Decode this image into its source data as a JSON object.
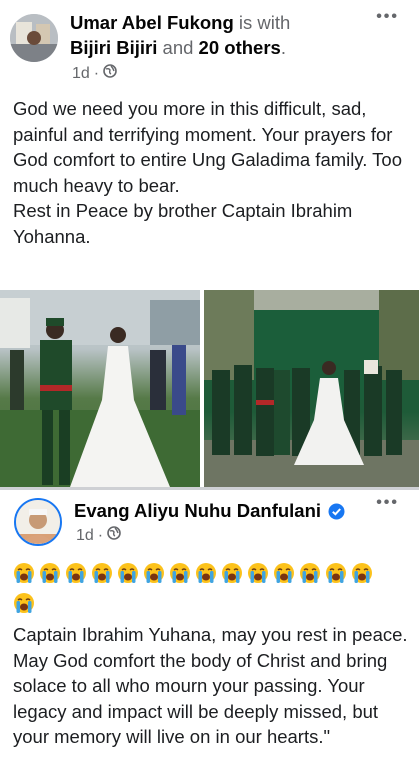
{
  "post1": {
    "author": "Umar Abel Fukong",
    "with_text": "is with",
    "tagged_1": "Bijiri Bijiri",
    "and_text": "and",
    "tagged_others": "20 others",
    "period": ".",
    "time": "1d",
    "dot": "·",
    "body": "God we need you more in this difficult, sad, painful and terrifying moment. Your prayers for God comfort to entire Ung Galadima family. Too much heavy to bear.\nRest in Peace by brother Captain Ibrahim Yohanna."
  },
  "post2": {
    "author": "Evang Aliyu Nuhu Danfulani",
    "time": "1d",
    "dot": "·",
    "emoji_count": 15,
    "emoji_name": "loudly-crying-face",
    "body": "Captain Ibrahim Yuhana, may you rest in peace. May God comfort the body of Christ and bring solace to all who mourn your passing. Your legacy and impact will be deeply missed, but your memory will live on in our hearts.\""
  },
  "icons": {
    "more": "•••",
    "globe": "globe-icon",
    "verified": "verified-badge-icon"
  },
  "colors": {
    "verified_blue": "#1877f2",
    "muted_text": "#65676b",
    "separator": "#ced0d4",
    "emoji_yellow": "#fcc21b",
    "tear_blue": "#40a4e0"
  }
}
